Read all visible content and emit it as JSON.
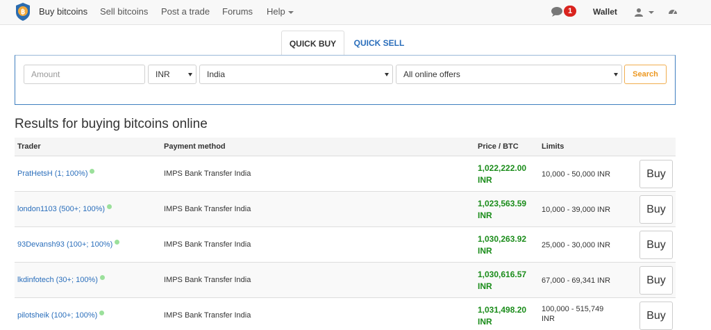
{
  "nav": {
    "items": [
      {
        "label": "Buy bitcoins"
      },
      {
        "label": "Sell bitcoins"
      },
      {
        "label": "Post a trade"
      },
      {
        "label": "Forums"
      },
      {
        "label": "Help"
      }
    ],
    "notification_count": "1",
    "wallet_label": "Wallet",
    "icons": [
      "logo-icon",
      "chat-icon",
      "user-icon",
      "dashboard-icon"
    ]
  },
  "quick": {
    "tabs": [
      {
        "label": "QUICK BUY",
        "active": true
      },
      {
        "label": "QUICK SELL",
        "active": false
      }
    ],
    "amount_placeholder": "Amount",
    "currency": "INR",
    "country": "India",
    "offer_type": "All online offers",
    "search_label": "Search"
  },
  "results": {
    "title": "Results for buying bitcoins online",
    "columns": [
      "Trader",
      "Payment method",
      "Price / BTC",
      "Limits"
    ],
    "rows": [
      {
        "trader": "PratHetsH (1; 100%)",
        "method": "IMPS Bank Transfer India",
        "price": "1,022,222.00",
        "currency": "INR",
        "limits": "10,000 - 50,000 INR",
        "buy": "Buy"
      },
      {
        "trader": "london1103 (500+; 100%)",
        "method": "IMPS Bank Transfer India",
        "price": "1,023,563.59",
        "currency": "INR",
        "limits": "10,000 - 39,000 INR",
        "buy": "Buy"
      },
      {
        "trader": "93Devansh93 (100+; 100%)",
        "method": "IMPS Bank Transfer India",
        "price": "1,030,263.92",
        "currency": "INR",
        "limits": "25,000 - 30,000 INR",
        "buy": "Buy"
      },
      {
        "trader": "lkdinfotech (30+; 100%)",
        "method": "IMPS Bank Transfer India",
        "price": "1,030,616.57",
        "currency": "INR",
        "limits": "67,000 - 69,341 INR",
        "buy": "Buy"
      },
      {
        "trader": "pilotsheik (100+; 100%)",
        "method": "IMPS Bank Transfer India",
        "price": "1,031,498.20",
        "currency": "INR",
        "limits": "100,000 - 515,749 INR",
        "buy": "Buy"
      }
    ]
  },
  "colors": {
    "link": "#2a6ebb",
    "price": "#1a8c1a",
    "badge": "#d9231e",
    "search_accent": "#f0ad4e",
    "online_dot": "#9be09b"
  }
}
